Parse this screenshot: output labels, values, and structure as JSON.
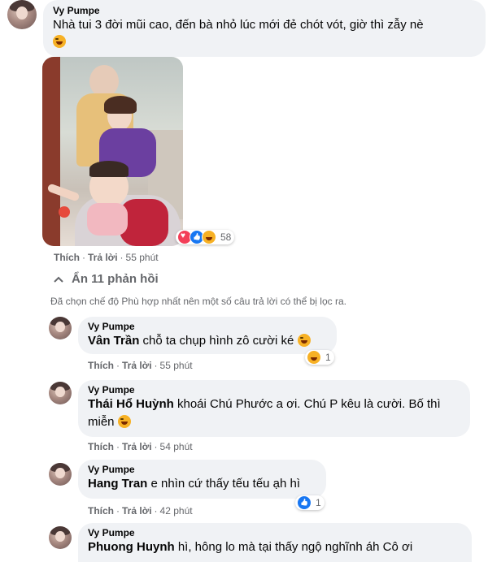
{
  "comments": [
    {
      "tag": "Vy Pumpe",
      "author": "",
      "text": "Nhà tui 3 đời mũi cao, đến bà nhỏ lúc mới đẻ chót vót, giờ thì zẫy nè",
      "reaction_count": "58",
      "like": "Thích",
      "reply": "Trả lời",
      "time": "55 phút"
    },
    {
      "tag": "Vy Pumpe",
      "author": "Vân Trần",
      "text": "chỗ ta chụp hình zô cười ké",
      "reaction_count": "1",
      "like": "Thích",
      "reply": "Trả lời",
      "time": "55 phút"
    },
    {
      "tag": "Vy Pumpe",
      "author": "Thái Hổ Huỳnh",
      "text_line1": "khoái Chú Phước a ơi. Chú P kêu là cười. Bố thì",
      "text_line2": "miễn",
      "like": "Thích",
      "reply": "Trả lời",
      "time": "54 phút"
    },
    {
      "tag": "Vy Pumpe",
      "author": "Hang Tran",
      "text": "e nhìn cứ thấy tếu tếu ạh hì",
      "reaction_count": "1",
      "like": "Thích",
      "reply": "Trả lời",
      "time": "42 phút"
    },
    {
      "tag": "Vy Pumpe",
      "author": "Phuong Huynh",
      "text": "hì, hông lo mà tại thấy ngộ nghĩnh áh Cô ơi"
    }
  ],
  "hide_replies": "Ẩn 11 phản hồi",
  "filter_notice": "Đã chọn chế độ Phù hợp nhất nên một số câu trả lời có thể bị lọc ra.",
  "colors": {
    "bubble": "#f0f2f5",
    "meta": "#65676b",
    "like_blue": "#1877f2",
    "love_red": "#f33e58",
    "haha_yellow": "#f7b125"
  }
}
